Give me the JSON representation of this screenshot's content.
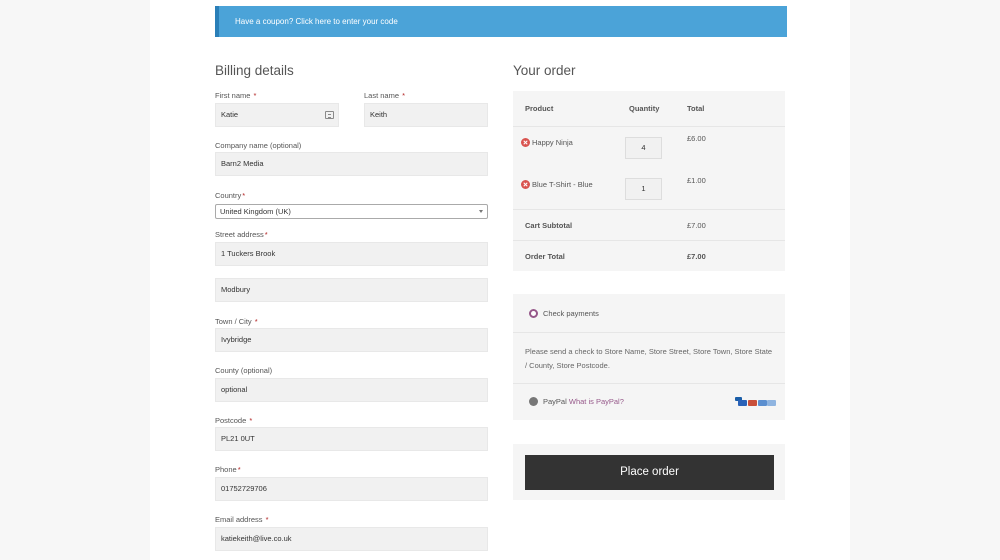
{
  "coupon": {
    "text": "Have a coupon? Click here to enter your code"
  },
  "billing": {
    "heading": "Billing details",
    "required_mark": "*",
    "first_name": {
      "label": "First name",
      "value": "Katie"
    },
    "last_name": {
      "label": "Last name",
      "value": "Keith"
    },
    "company": {
      "label": "Company name (optional)",
      "value": "Barn2 Media"
    },
    "country": {
      "label": "Country",
      "value": "United Kingdom (UK)"
    },
    "street": {
      "label": "Street address",
      "value": "1 Tuckers Brook",
      "value2": "Modbury"
    },
    "town": {
      "label": "Town / City",
      "value": "Ivybridge"
    },
    "county": {
      "label": "County (optional)",
      "value": "optional"
    },
    "postcode": {
      "label": "Postcode",
      "value": "PL21 0UT"
    },
    "phone": {
      "label": "Phone",
      "value": "01752729706"
    },
    "email": {
      "label": "Email address",
      "value": "katiekeith@live.co.uk"
    }
  },
  "order": {
    "heading": "Your order",
    "col_product": "Product",
    "col_quantity": "Quantity",
    "col_total": "Total",
    "items": [
      {
        "name": "Happy Ninja",
        "qty": "4",
        "total": "£6.00"
      },
      {
        "name": "Blue T-Shirt - Blue",
        "qty": "1",
        "total": "£1.00"
      }
    ],
    "subtotal_label": "Cart Subtotal",
    "subtotal_value": "£7.00",
    "total_label": "Order Total",
    "total_value": "£7.00"
  },
  "payment": {
    "check_label": "Check payments",
    "check_desc": "Please send a check to Store Name, Store Street, Store Town, Store State / County, Store Postcode.",
    "paypal_label": "PayPal",
    "paypal_link": "What is PayPal?",
    "accent_color": "#96588a"
  },
  "place_order": "Place order"
}
